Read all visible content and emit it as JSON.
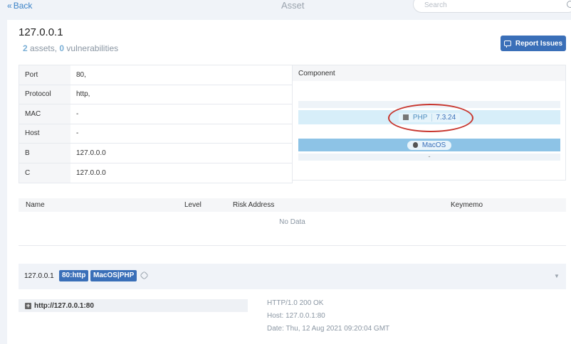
{
  "topbar": {
    "back_label": "Back",
    "title": "Asset",
    "search_placeholder": "Search"
  },
  "asset": {
    "ip": "127.0.0.1",
    "assets_count": "2",
    "assets_label": "assets,",
    "vulns_count": "0",
    "vulns_label": "vulnerabilities"
  },
  "report_button": "Report Issues",
  "info": [
    {
      "key": "Port",
      "value": "80,"
    },
    {
      "key": "Protocol",
      "value": "http,"
    },
    {
      "key": "MAC",
      "value": "-"
    },
    {
      "key": "Host",
      "value": "-"
    },
    {
      "key": "B",
      "value": "127.0.0.0"
    },
    {
      "key": "C",
      "value": "127.0.0.0"
    }
  ],
  "component": {
    "header": "Component",
    "dash_top": "-",
    "php_name": "PHP",
    "php_version": "7.3.24",
    "os_name": "MacOS",
    "dash_bottom": "-"
  },
  "vuln_table": {
    "columns": [
      "Name",
      "Level",
      "Risk Address",
      "Keymemo"
    ],
    "empty_text": "No Data"
  },
  "service": {
    "ip": "127.0.0.1",
    "tags": [
      "80:http",
      "MacOS|PHP"
    ],
    "url": "http://127.0.0.1:80",
    "response_lines": [
      "HTTP/1.0 200 OK",
      "Host: 127.0.0.1:80",
      "Date: Thu, 12 Aug 2021 09:20:04 GMT"
    ]
  },
  "colors": {
    "accent": "#3a6fb8",
    "annotation_circle": "#c8362e",
    "php_row": "#d7eef9",
    "os_row": "#8dc3e6"
  }
}
